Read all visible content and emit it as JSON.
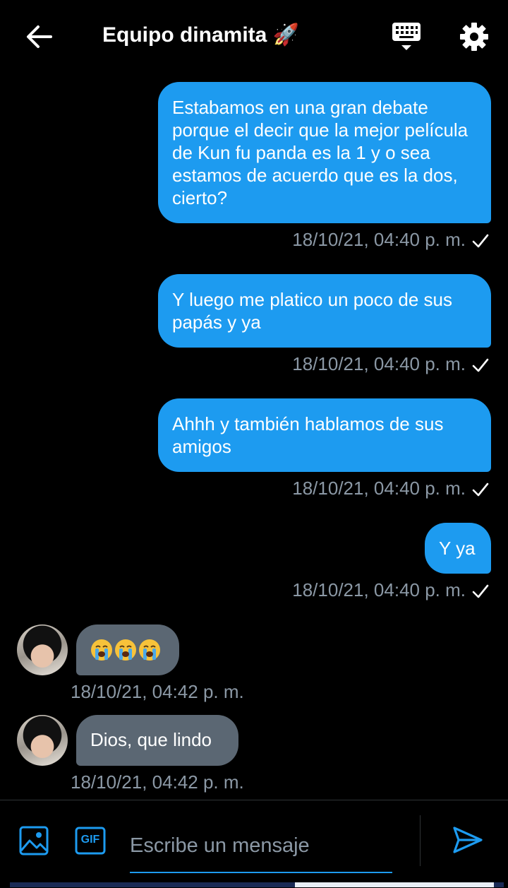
{
  "header": {
    "title": "Equipo dinamita 🚀"
  },
  "icons": {
    "back": "arrow-left-icon",
    "keyboard": "keyboard-icon",
    "settings": "gear-icon",
    "image": "image-icon",
    "gif": "gif-icon",
    "send": "send-icon"
  },
  "messages": [
    {
      "direction": "out",
      "text": "Estabamos en una gran debate porque el decir que la mejor película de Kun fu panda es la 1 y o sea estamos de acuerdo que es la dos, cierto?",
      "time": "18/10/21, 04:40 p. m.",
      "status": "sent"
    },
    {
      "direction": "out",
      "text": "Y luego me platico un poco de sus papás y ya",
      "time": "18/10/21, 04:40 p. m.",
      "status": "sent"
    },
    {
      "direction": "out",
      "text": "Ahhh y también hablamos de sus amigos",
      "time": "18/10/21, 04:40 p. m.",
      "status": "sent"
    },
    {
      "direction": "out",
      "text": "Y ya",
      "time": "18/10/21, 04:40 p. m.",
      "status": "sent"
    },
    {
      "direction": "in",
      "text": "",
      "emojis": [
        "loudly-crying-face",
        "loudly-crying-face",
        "loudly-crying-face"
      ],
      "time": "18/10/21, 04:42 p. m."
    },
    {
      "direction": "in",
      "text": "Dios, que lindo",
      "time": "18/10/21, 04:42 p. m."
    }
  ],
  "composer": {
    "placeholder": "Escribe un mensaje",
    "gif_label": "GIF"
  },
  "colors": {
    "background": "#000000",
    "outgoing_bubble": "#1d9bf0",
    "incoming_bubble": "#5b6773",
    "timestamp": "#8b98a5",
    "accent": "#1d9bf0"
  }
}
